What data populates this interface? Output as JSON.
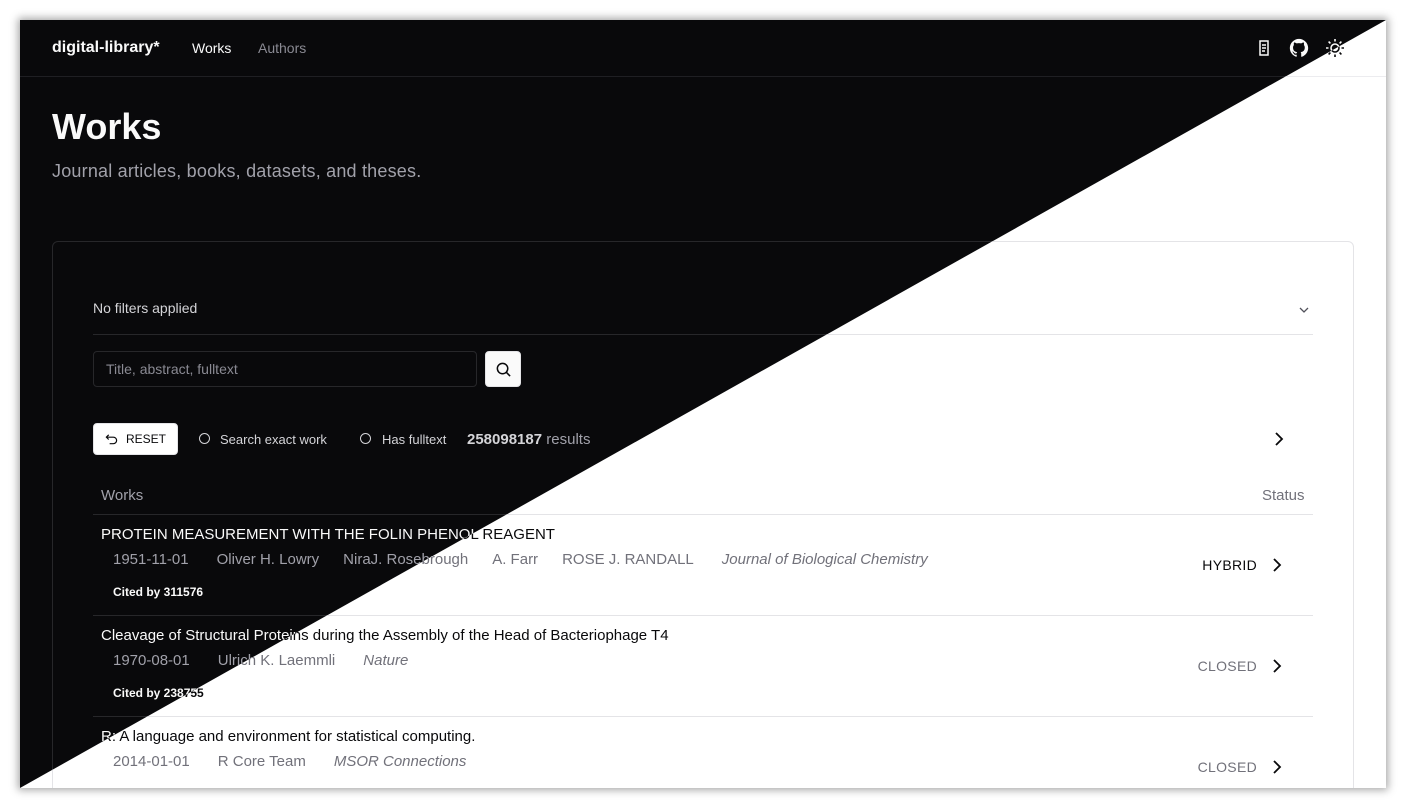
{
  "app": {
    "brand": "digital-library*"
  },
  "nav": {
    "items": [
      {
        "label": "Works"
      },
      {
        "label": "Authors"
      }
    ]
  },
  "header_icons": [
    "language-icon",
    "github-icon",
    "theme-toggle-icon"
  ],
  "page": {
    "title": "Works",
    "subtitle": "Journal articles, books, datasets, and theses."
  },
  "filters": {
    "summary": "No filters applied"
  },
  "search": {
    "placeholder": "Title, abstract, fulltext",
    "value": ""
  },
  "controls": {
    "reset_label": "RESET",
    "exact_label": "Search exact work",
    "fulltext_label": "Has fulltext",
    "result_count": "258098187",
    "result_suffix": " results"
  },
  "table": {
    "col_works": "Works",
    "col_status": "Status",
    "rows": [
      {
        "title": "PROTEIN MEASUREMENT WITH THE FOLIN PHENOL REAGENT",
        "date": "1951-11-01",
        "authors": [
          "Oliver H. Lowry",
          "NiraJ. Rosebrough",
          "A. Farr",
          "ROSE J. RANDALL"
        ],
        "venue": "Journal of Biological Chemistry",
        "cited": "Cited by 311576",
        "status": "HYBRID"
      },
      {
        "title": "Cleavage of Structural Proteins during the Assembly of the Head of Bacteriophage T4",
        "date": "1970-08-01",
        "authors": [
          "Ulrich K. Laemmli"
        ],
        "venue": "Nature",
        "cited": "Cited by 238755",
        "status": "CLOSED"
      },
      {
        "title": "R: A language and environment for statistical computing.",
        "date": "2014-01-01",
        "authors": [
          "R Core Team"
        ],
        "venue": "MSOR Connections",
        "status": "CLOSED"
      }
    ]
  },
  "colors": {
    "dark_bg": "#09090b",
    "light_bg": "#ffffff",
    "muted": "#a1a1aa"
  }
}
